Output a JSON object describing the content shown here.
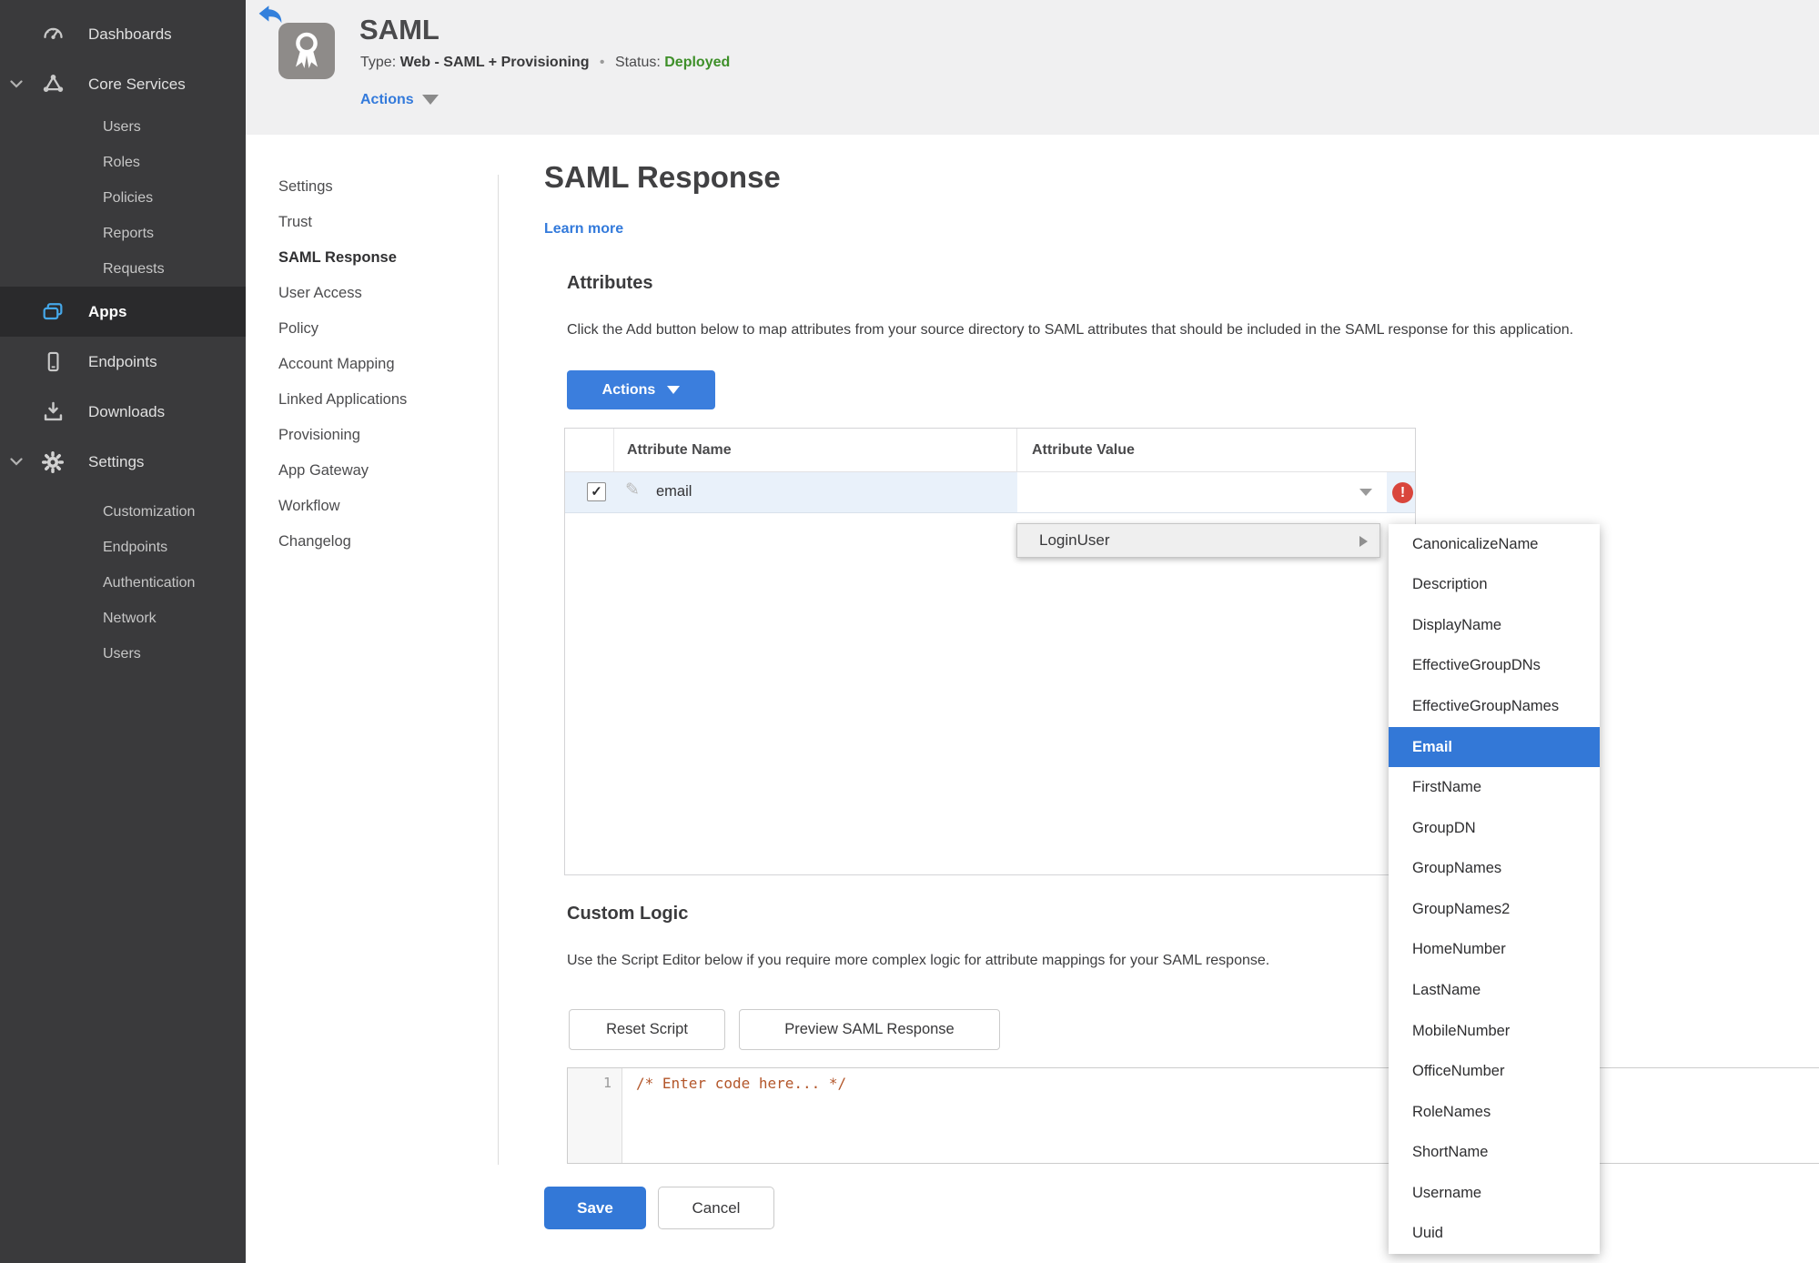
{
  "accent": "#337ADB",
  "status_green": "#3E8F29",
  "error_red": "#D9463C",
  "sidebar": {
    "dashboards": "Dashboards",
    "core_services": "Core Services",
    "core_sub": [
      "Users",
      "Roles",
      "Policies",
      "Reports",
      "Requests"
    ],
    "apps": "Apps",
    "endpoints": "Endpoints",
    "downloads": "Downloads",
    "settings": "Settings",
    "settings_sub": [
      "Customization",
      "Endpoints",
      "Authentication",
      "Network",
      "Users"
    ]
  },
  "header": {
    "title": "SAML",
    "type_label": "Type:",
    "type_value": "Web - SAML + Provisioning",
    "dot": "•",
    "status_label": "Status:",
    "status_value": "Deployed",
    "actions_label": "Actions"
  },
  "subnav": {
    "items": [
      "Settings",
      "Trust",
      "SAML Response",
      "User Access",
      "Policy",
      "Account Mapping",
      "Linked Applications",
      "Provisioning",
      "App Gateway",
      "Workflow",
      "Changelog"
    ],
    "active": "SAML Response"
  },
  "main": {
    "title": "SAML Response",
    "learn_more": "Learn more",
    "attributes": {
      "heading": "Attributes",
      "description": "Click the Add button below to map attributes from your source directory to SAML attributes that should be included in the SAML response for this application.",
      "actions_button": "Actions",
      "table": {
        "col_name": "Attribute Name",
        "col_value": "Attribute Value",
        "row": {
          "checked": "✓",
          "name": "email",
          "value": "",
          "error": "!"
        }
      }
    },
    "custom_logic": {
      "heading": "Custom Logic",
      "description": "Use the Script Editor below if you require more complex logic for attribute mappings for your SAML response.",
      "reset_button": "Reset Script",
      "preview_button": "Preview SAML Response",
      "editor": {
        "line_number": "1",
        "code": "/* Enter code here... */"
      }
    },
    "save_button": "Save",
    "cancel_button": "Cancel"
  },
  "dropdown": {
    "parent_item": "LoginUser",
    "selected": "Email",
    "items": [
      "CanonicalizeName",
      "Description",
      "DisplayName",
      "EffectiveGroupDNs",
      "EffectiveGroupNames",
      "Email",
      "FirstName",
      "GroupDN",
      "GroupNames",
      "GroupNames2",
      "HomeNumber",
      "LastName",
      "MobileNumber",
      "OfficeNumber",
      "RoleNames",
      "ShortName",
      "Username",
      "Uuid"
    ]
  }
}
